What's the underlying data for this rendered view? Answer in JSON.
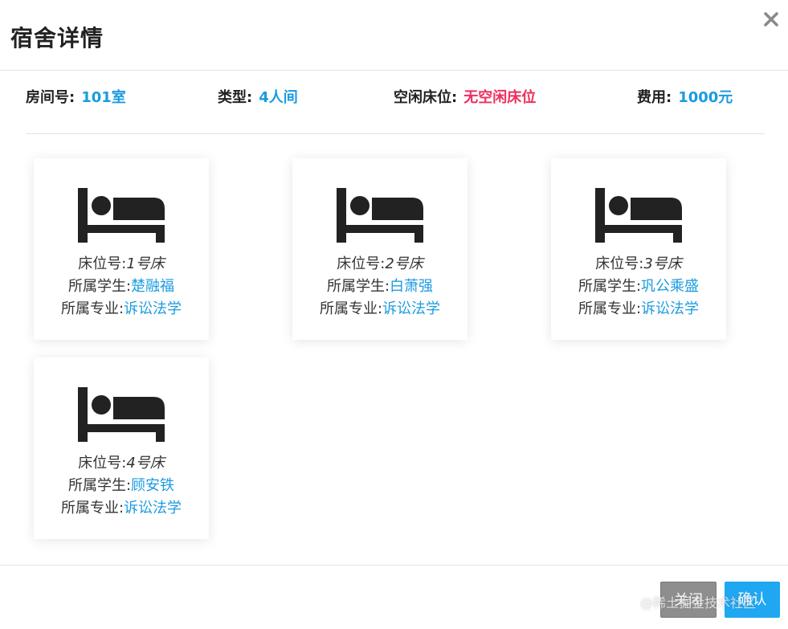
{
  "header": {
    "title": "宿舍详情"
  },
  "info": {
    "room_label": "房间号:",
    "room_value": "101室",
    "type_label": "类型:",
    "type_value": "4人间",
    "free_label": "空闲床位:",
    "free_value": "无空闲床位",
    "fee_label": "费用:",
    "fee_value": "1000元"
  },
  "bed_labels": {
    "bed": "床位号:",
    "student": "所属学生:",
    "major": "所属专业:"
  },
  "beds": [
    {
      "bed": "1号床",
      "student": "楚融福",
      "major": "诉讼法学"
    },
    {
      "bed": "2号床",
      "student": "白萧强",
      "major": "诉讼法学"
    },
    {
      "bed": "3号床",
      "student": "巩公乘盛",
      "major": "诉讼法学"
    },
    {
      "bed": "4号床",
      "student": "顾安铁",
      "major": "诉讼法学"
    }
  ],
  "footer": {
    "close_label": "关闭",
    "ok_label": "确认"
  },
  "watermark": "@稀土掘金技术社区",
  "colors": {
    "accent": "#1a9be0",
    "warning": "#ef2d5e",
    "primary_button": "#1fa7f2",
    "secondary_button": "#8e8e8e"
  },
  "icons": {
    "close": "close-icon",
    "bed": "bed-icon"
  }
}
